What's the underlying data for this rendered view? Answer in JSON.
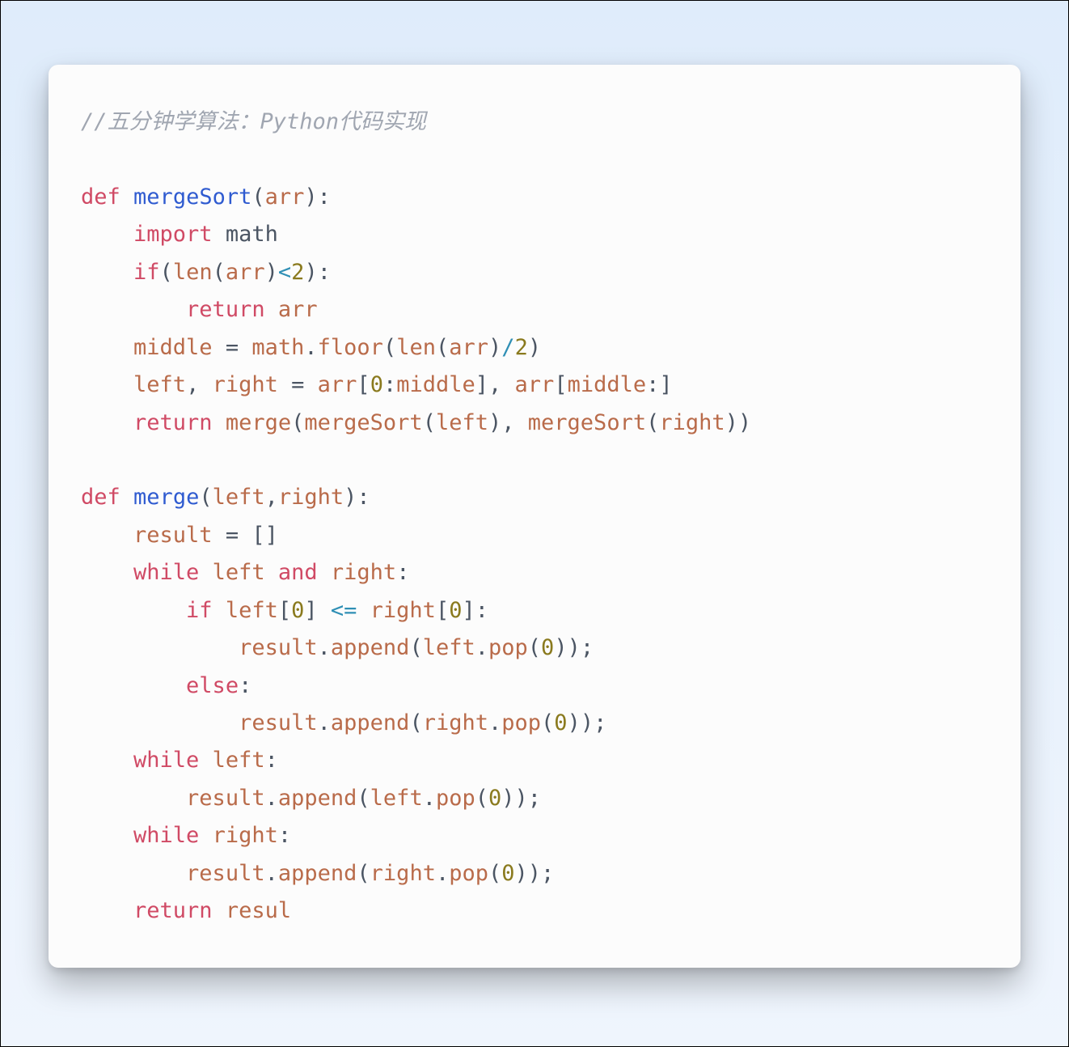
{
  "comment": "//五分钟学算法：Python代码实现",
  "code": {
    "l1_def": "def",
    "l1_fn": "mergeSort",
    "l1_open": "(",
    "l1_arg": "arr",
    "l1_close": "):",
    "l2_kw": "import",
    "l2_mod": " math",
    "l3_if": "if",
    "l3_open": "(",
    "l3_len": "len",
    "l3_p1": "(",
    "l3_arr": "arr",
    "l3_p2": ")",
    "l3_lt": "<",
    "l3_two": "2",
    "l3_close": "):",
    "l4_ret": "return",
    "l4_arr": " arr",
    "l5_mid": "middle",
    "l5_eq": " = ",
    "l5_math": "math",
    "l5_dot": ".",
    "l5_floor": "floor",
    "l5_open": "(",
    "l5_len": "len",
    "l5_p1": "(",
    "l5_arr": "arr",
    "l5_p2": ")",
    "l5_div": "/",
    "l5_two": "2",
    "l5_close": ")",
    "l6_left": "left",
    "l6_c1": ", ",
    "l6_right": "right",
    "l6_eq": " = ",
    "l6_arr1": "arr",
    "l6_b1": "[",
    "l6_zero": "0",
    "l6_colon": ":",
    "l6_mid1": "middle",
    "l6_b2": "], ",
    "l6_arr2": "arr",
    "l6_b3": "[",
    "l6_mid2": "middle",
    "l6_b4": ":]",
    "l7_ret": "return",
    "l7_sp": " ",
    "l7_merge": "merge",
    "l7_open": "(",
    "l7_ms1": "mergeSort",
    "l7_p1": "(",
    "l7_left": "left",
    "l7_p2": "), ",
    "l7_ms2": "mergeSort",
    "l7_p3": "(",
    "l7_right": "right",
    "l7_p4": "))",
    "l8_def": "def",
    "l8_fn": "merge",
    "l8_open": "(",
    "l8_left": "left",
    "l8_c": ",",
    "l8_right": "right",
    "l8_close": "):",
    "l9_res": "result",
    "l9_eq": " = []",
    "l10_while": "while",
    "l10_left": " left",
    "l10_and": "and",
    "l10_right": " right",
    "l10_colon": ":",
    "l11_if": "if",
    "l11_left": " left",
    "l11_b1": "[",
    "l11_z1": "0",
    "l11_b2": "] ",
    "l11_le": "<=",
    "l11_right": " right",
    "l11_b3": "[",
    "l11_z2": "0",
    "l11_b4": "]:",
    "l12_res": "result",
    "l12_dot": ".",
    "l12_app": "append",
    "l12_open": "(",
    "l12_left": "left",
    "l12_dot2": ".",
    "l12_pop": "pop",
    "l12_p1": "(",
    "l12_z": "0",
    "l12_close": "));",
    "l13_else": "else",
    "l13_colon": ":",
    "l14_res": "result",
    "l14_dot": ".",
    "l14_app": "append",
    "l14_open": "(",
    "l14_right": "right",
    "l14_dot2": ".",
    "l14_pop": "pop",
    "l14_p1": "(",
    "l14_z": "0",
    "l14_close": "));",
    "l15_while": "while",
    "l15_left": " left",
    "l15_colon": ":",
    "l16_res": "result",
    "l16_dot": ".",
    "l16_app": "append",
    "l16_open": "(",
    "l16_left": "left",
    "l16_dot2": ".",
    "l16_pop": "pop",
    "l16_p1": "(",
    "l16_z": "0",
    "l16_close": "));",
    "l17_while": "while",
    "l17_right": " right",
    "l17_colon": ":",
    "l18_res": "result",
    "l18_dot": ".",
    "l18_app": "append",
    "l18_open": "(",
    "l18_right": "right",
    "l18_dot2": ".",
    "l18_pop": "pop",
    "l18_p1": "(",
    "l18_z": "0",
    "l18_close": "));",
    "l19_ret": "return",
    "l19_res": " resul"
  }
}
